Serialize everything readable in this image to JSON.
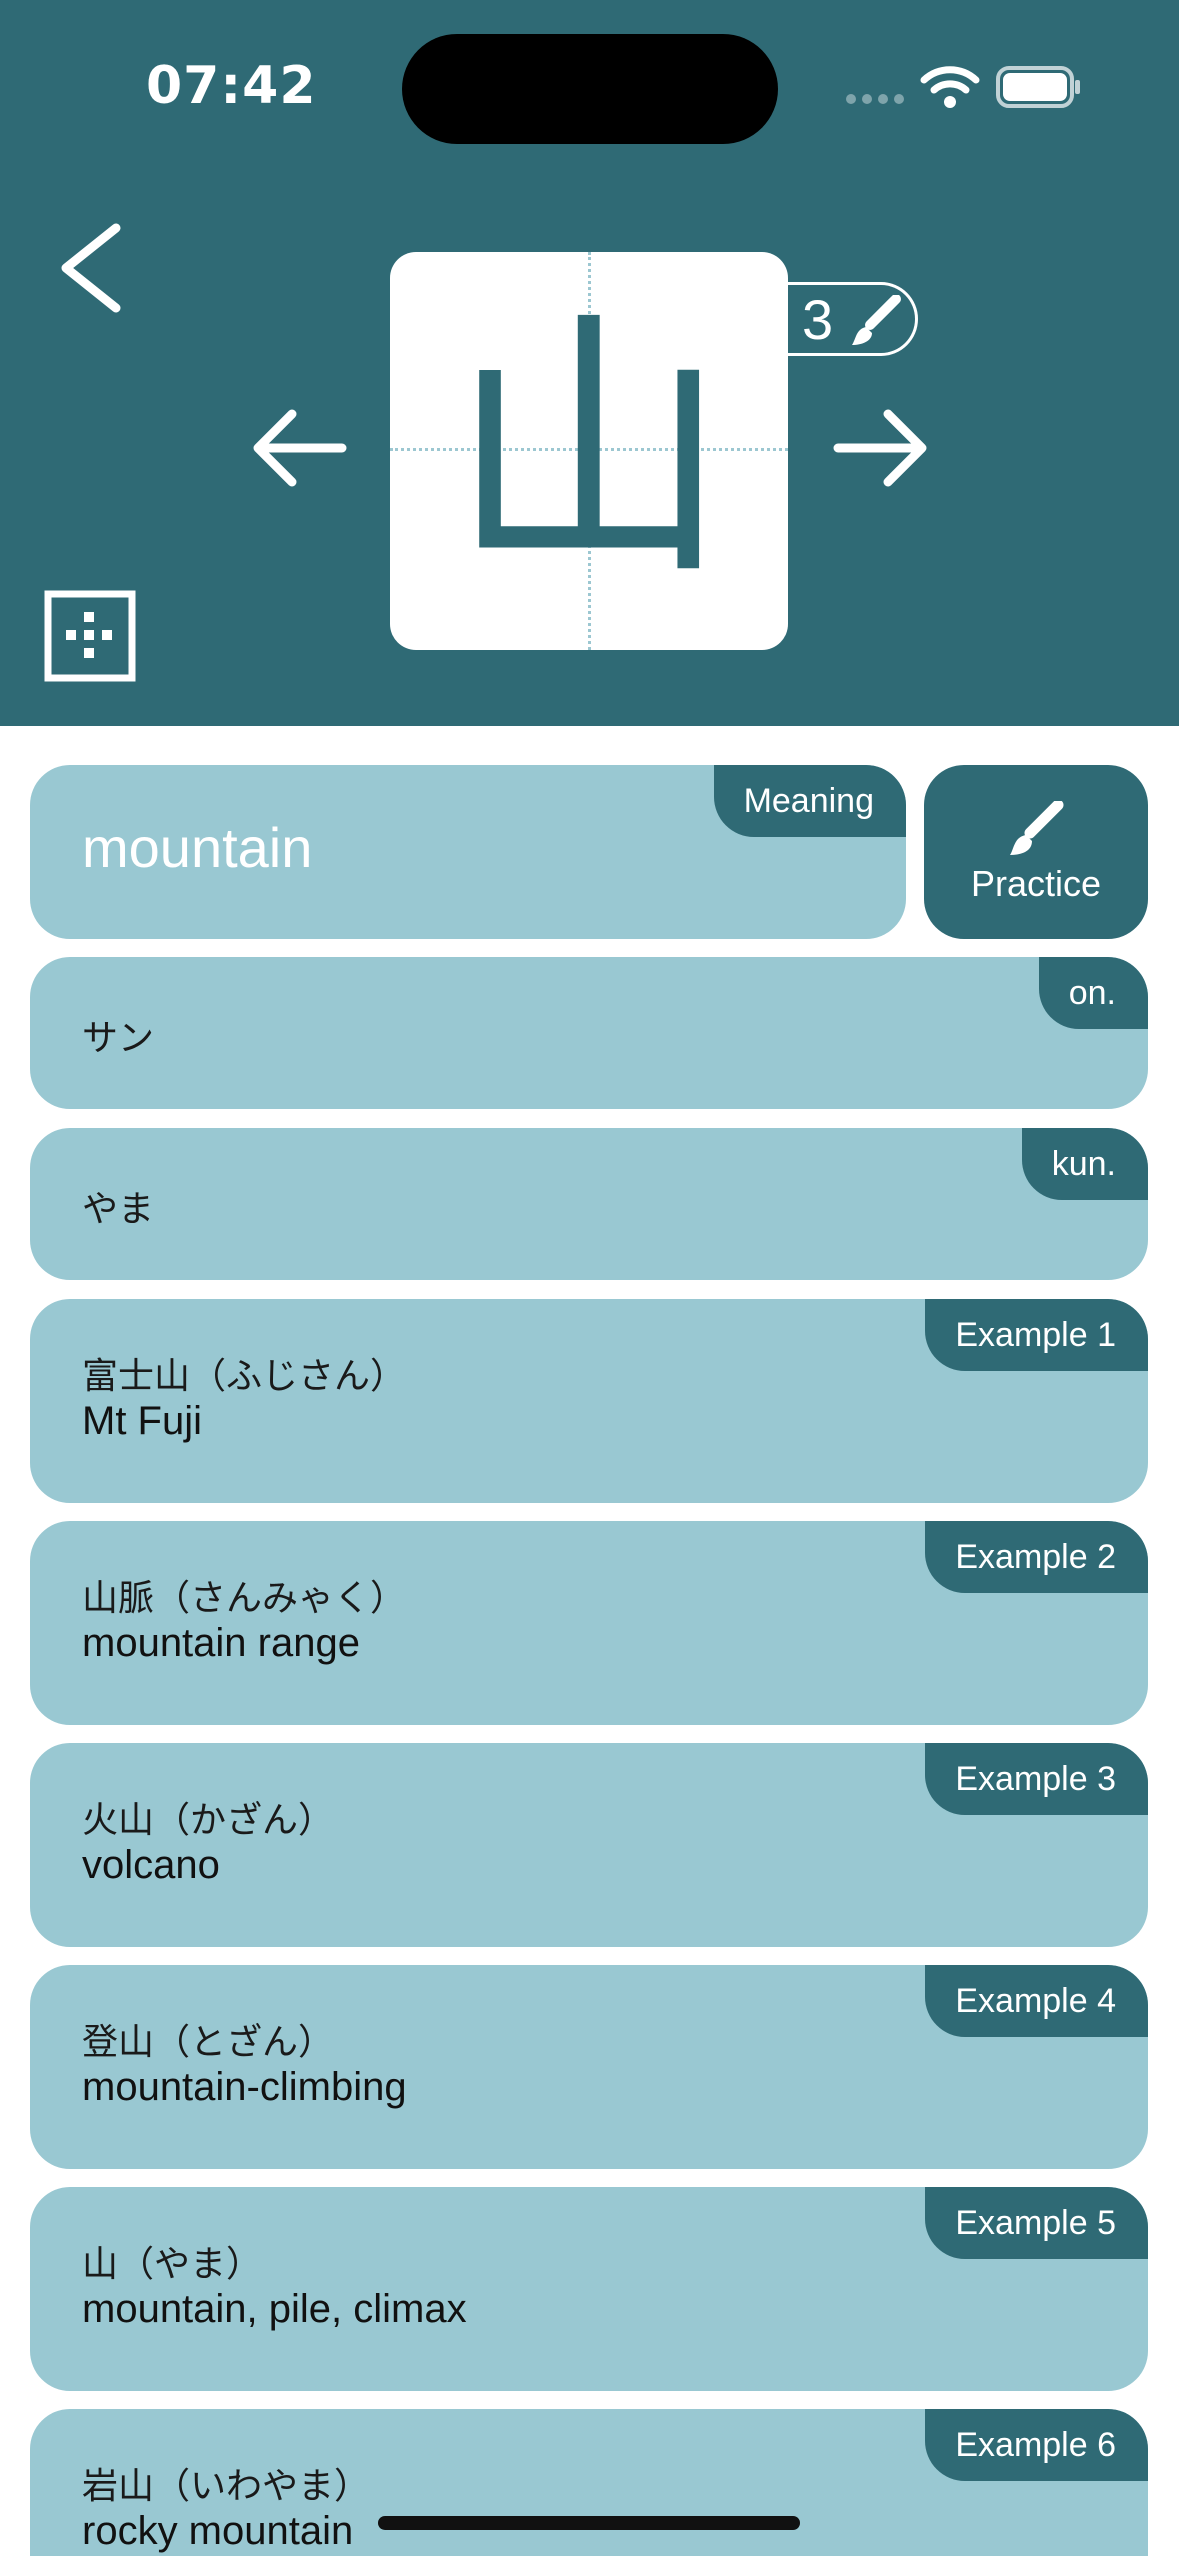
{
  "status_bar": {
    "time": "07:42"
  },
  "kanji": {
    "character": "山",
    "stroke_count": "3"
  },
  "icons": {
    "back": "chevron-left-icon",
    "previous": "arrow-left-icon",
    "next": "arrow-right-icon",
    "grid": "grid-icon",
    "brush": "brush-icon"
  },
  "meaning": {
    "tag": "Meaning",
    "text": "mountain"
  },
  "practice": {
    "label": "Practice"
  },
  "readings": [
    {
      "tag": "on.",
      "text": "サン"
    },
    {
      "tag": "kun.",
      "text": "やま"
    }
  ],
  "examples": [
    {
      "tag": "Example 1",
      "word": "富士山（ふじさん）",
      "meaning": "Mt Fuji"
    },
    {
      "tag": "Example 2",
      "word": "山脈（さんみゃく）",
      "meaning": "mountain range"
    },
    {
      "tag": "Example 3",
      "word": "火山（かざん）",
      "meaning": "volcano"
    },
    {
      "tag": "Example 4",
      "word": "登山（とざん）",
      "meaning": "mountain-climbing"
    },
    {
      "tag": "Example 5",
      "word": "山（やま）",
      "meaning": "mountain, pile, climax"
    },
    {
      "tag": "Example 6",
      "word": "岩山（いわやま）",
      "meaning": "rocky mountain"
    }
  ],
  "colors": {
    "header": "#2f6a75",
    "card": "#99c8d2",
    "tag": "#2f6a75"
  }
}
